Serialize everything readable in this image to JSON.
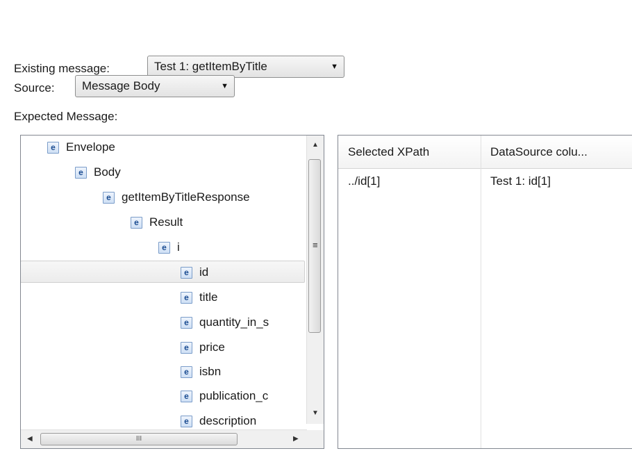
{
  "form": {
    "existing_message_label": "Existing message:",
    "existing_message_value": "Test 1: getItemByTitle",
    "source_label": "Source:",
    "source_value": "Message Body",
    "expected_message_label": "Expected Message:"
  },
  "tree": {
    "icon_letter": "e",
    "nodes": [
      {
        "label": "Envelope"
      },
      {
        "label": "Body"
      },
      {
        "label": "getItemByTitleResponse"
      },
      {
        "label": "Result"
      },
      {
        "label": "i"
      },
      {
        "label": "id",
        "selected": true
      },
      {
        "label": "title"
      },
      {
        "label": "quantity_in_s"
      },
      {
        "label": "price"
      },
      {
        "label": "isbn"
      },
      {
        "label": "publication_c"
      },
      {
        "label": "description"
      }
    ],
    "hscroll_grip": "III"
  },
  "table": {
    "columns": [
      "Selected XPath",
      "DataSource colu..."
    ],
    "rows": [
      [
        "../id[1]",
        "Test 1: id[1]"
      ]
    ]
  }
}
